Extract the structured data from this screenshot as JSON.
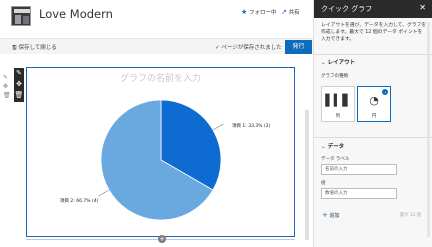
{
  "header": {
    "site_title": "Love Modern",
    "follow_label": "フォロー中",
    "share_label": "共有"
  },
  "command_bar": {
    "save_close_label": "保存して閉じる",
    "saved_status": "ページが保存されました",
    "publish_label": "発行"
  },
  "chart_data": {
    "type": "pie",
    "title": "グラフの名前を入力",
    "categories": [
      "項目 1",
      "項目 2"
    ],
    "values": [
      2,
      4
    ],
    "data_labels": [
      "項目 1: 33.3% (2)",
      "項目 2: 66.7% (4)"
    ],
    "colors": [
      "#0e6bd1",
      "#6aa8e0"
    ]
  },
  "panel": {
    "title": "クイック グラフ",
    "description": "レイアウトを選び、データを入力して、グラフを作成します。最大で 12 個のデータ ポイントを入力できます。",
    "layout_section": "レイアウト",
    "chart_type_label": "グラフの種類",
    "type_options": [
      {
        "label": "列",
        "icon": "column-chart-icon",
        "selected": false
      },
      {
        "label": "円",
        "icon": "pie-chart-icon",
        "selected": true
      }
    ],
    "data_section": "データ",
    "data_label_title": "データ ラベル",
    "data_label_placeholder": "名前の入力",
    "value_title": "値",
    "value_placeholder": "数値の入力",
    "add_label": "追加",
    "max_note": "最大 12 個"
  }
}
